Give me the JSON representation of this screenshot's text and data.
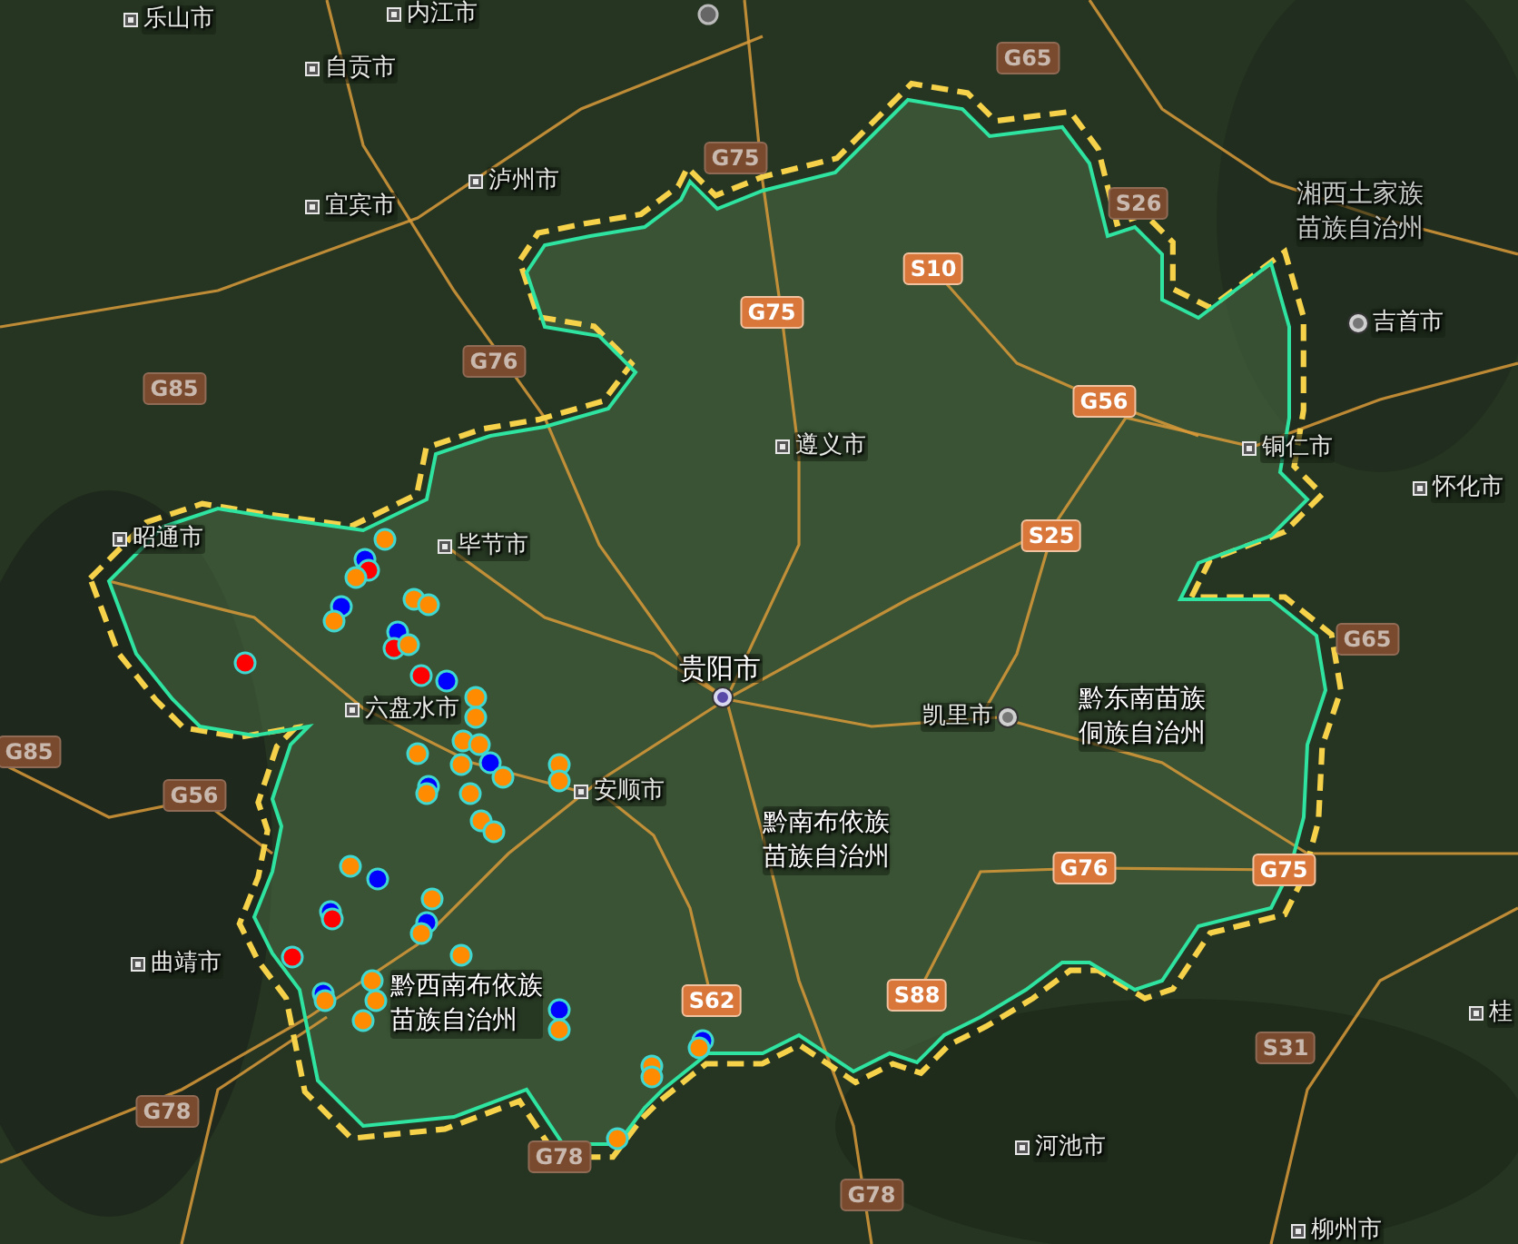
{
  "map": {
    "cities": [
      {
        "name": "乐山市",
        "kind": "prefecture"
      },
      {
        "name": "内江市",
        "kind": "prefecture"
      },
      {
        "name": "自贡市",
        "kind": "prefecture"
      },
      {
        "name": "泸州市",
        "kind": "prefecture"
      },
      {
        "name": "宜宾市",
        "kind": "prefecture"
      },
      {
        "name": "昭通市",
        "kind": "prefecture"
      },
      {
        "name": "毕节市",
        "kind": "prefecture"
      },
      {
        "name": "遵义市",
        "kind": "prefecture"
      },
      {
        "name": "铜仁市",
        "kind": "prefecture"
      },
      {
        "name": "吉首市",
        "kind": "seat"
      },
      {
        "name": "怀化市",
        "kind": "prefecture"
      },
      {
        "name": "贵阳市",
        "kind": "capital"
      },
      {
        "name": "六盘水市",
        "kind": "prefecture"
      },
      {
        "name": "安顺市",
        "kind": "prefecture"
      },
      {
        "name": "曲靖市",
        "kind": "prefecture"
      },
      {
        "name": "凯里市",
        "kind": "seat"
      },
      {
        "name": "河池市",
        "kind": "prefecture"
      },
      {
        "name": "柳州市",
        "kind": "prefecture"
      },
      {
        "name": "桂",
        "kind": "prefecture"
      }
    ],
    "regions": [
      {
        "name": "湘西土家族苗族自治州"
      },
      {
        "name": "黔东南苗族侗族自治州"
      },
      {
        "name": "黔南布依族苗族自治州"
      },
      {
        "name": "黔西南布依族苗族自治州"
      }
    ],
    "highways": [
      {
        "code": "G65",
        "dimmed": true
      },
      {
        "code": "G75",
        "dimmed": true
      },
      {
        "code": "S26",
        "dimmed": true
      },
      {
        "code": "S10",
        "dimmed": false
      },
      {
        "code": "G75",
        "dimmed": false
      },
      {
        "code": "G76",
        "dimmed": true
      },
      {
        "code": "G56",
        "dimmed": false
      },
      {
        "code": "G85",
        "dimmed": true
      },
      {
        "code": "S25",
        "dimmed": false
      },
      {
        "code": "G65",
        "dimmed": true
      },
      {
        "code": "G85",
        "dimmed": true
      },
      {
        "code": "G56",
        "dimmed": true
      },
      {
        "code": "G76",
        "dimmed": false
      },
      {
        "code": "G75",
        "dimmed": false
      },
      {
        "code": "S62",
        "dimmed": false
      },
      {
        "code": "S88",
        "dimmed": false
      },
      {
        "code": "S31",
        "dimmed": true
      },
      {
        "code": "G78",
        "dimmed": true
      },
      {
        "code": "G78",
        "dimmed": true
      },
      {
        "code": "G78",
        "dimmed": true
      }
    ],
    "points": [
      {
        "color": "#ff8c00"
      },
      {
        "color": "#0000ff"
      },
      {
        "color": "#ff0000"
      },
      {
        "color": "#ff8c00"
      },
      {
        "color": "#0000ff"
      },
      {
        "color": "#ff8c00"
      },
      {
        "color": "#ff8c00"
      },
      {
        "color": "#ff8c00"
      },
      {
        "color": "#0000ff"
      },
      {
        "color": "#ff0000"
      },
      {
        "color": "#ff8c00"
      },
      {
        "color": "#ff0000"
      },
      {
        "color": "#ff0000"
      },
      {
        "color": "#0000ff"
      },
      {
        "color": "#ff8c00"
      },
      {
        "color": "#ff8c00"
      },
      {
        "color": "#ff8c00"
      },
      {
        "color": "#ff8c00"
      },
      {
        "color": "#ff8c00"
      },
      {
        "color": "#0000ff"
      },
      {
        "color": "#ff8c00"
      },
      {
        "color": "#ff8c00"
      },
      {
        "color": "#0000ff"
      },
      {
        "color": "#ff8c00"
      },
      {
        "color": "#ff8c00"
      },
      {
        "color": "#ff8c00"
      },
      {
        "color": "#ff8c00"
      },
      {
        "color": "#ff8c00"
      },
      {
        "color": "#ff8c00"
      },
      {
        "color": "#0000ff"
      },
      {
        "color": "#ff8c00"
      },
      {
        "color": "#0000ff"
      },
      {
        "color": "#ff0000"
      },
      {
        "color": "#0000ff"
      },
      {
        "color": "#ff8c00"
      },
      {
        "color": "#ff8c00"
      },
      {
        "color": "#ff0000"
      },
      {
        "color": "#0000ff"
      },
      {
        "color": "#ff8c00"
      },
      {
        "color": "#ff8c00"
      },
      {
        "color": "#ff8c00"
      },
      {
        "color": "#ff8c00"
      },
      {
        "color": "#ff8c00"
      },
      {
        "color": "#0000ff"
      },
      {
        "color": "#ff8c00"
      },
      {
        "color": "#ff8c00"
      },
      {
        "color": "#ff8c00"
      },
      {
        "color": "#0000ff"
      },
      {
        "color": "#ff8c00"
      },
      {
        "color": "#ff8c00"
      }
    ]
  }
}
